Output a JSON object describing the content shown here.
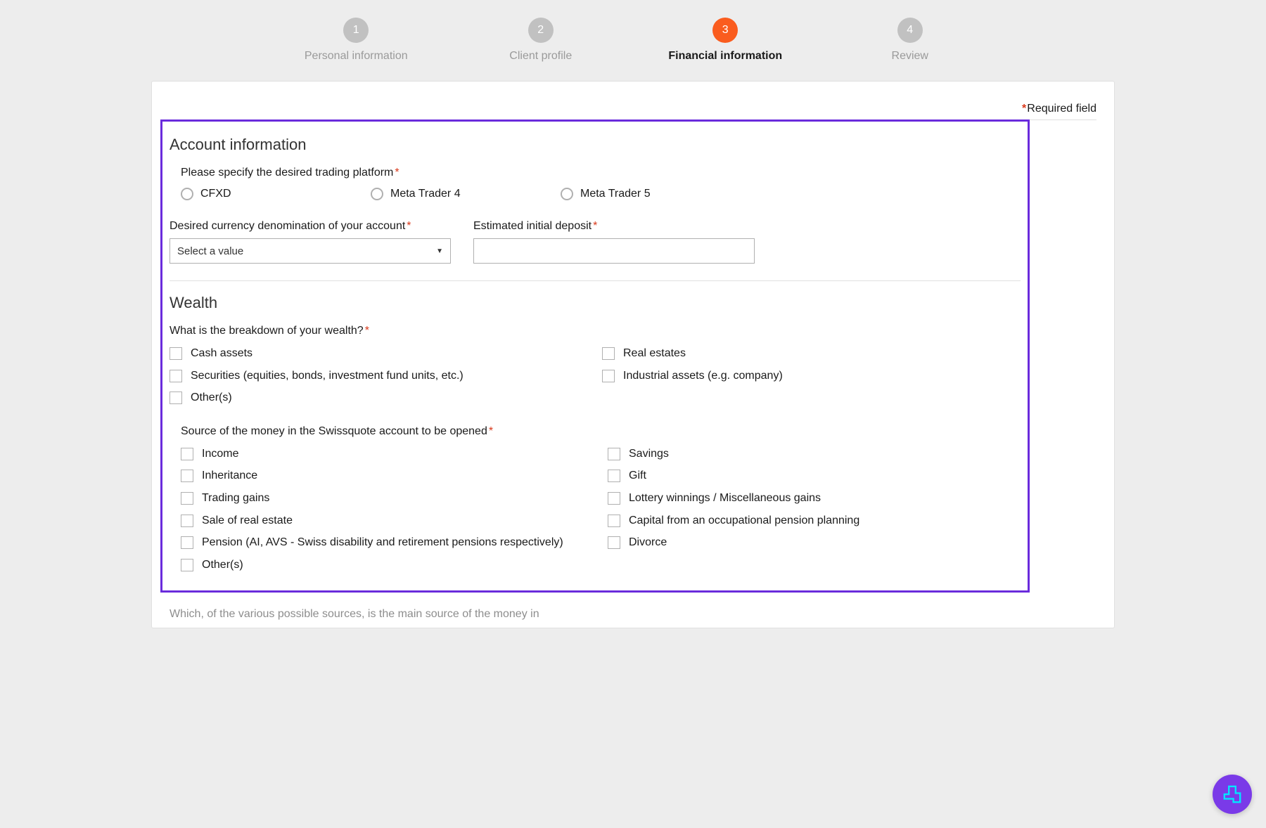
{
  "stepper": {
    "steps": [
      {
        "num": "1",
        "label": "Personal information",
        "active": false
      },
      {
        "num": "2",
        "label": "Client profile",
        "active": false
      },
      {
        "num": "3",
        "label": "Financial information",
        "active": true
      },
      {
        "num": "4",
        "label": "Review",
        "active": false
      }
    ]
  },
  "required_label": "Required field",
  "sections": {
    "account_info": {
      "title": "Account information",
      "platform_question": "Please specify the desired trading platform",
      "platform_options": [
        "CFXD",
        "Meta Trader 4",
        "Meta Trader 5"
      ],
      "currency_label": "Desired currency denomination of your account",
      "currency_placeholder": "Select a value",
      "deposit_label": "Estimated initial deposit"
    },
    "wealth": {
      "title": "Wealth",
      "breakdown_question": "What is the breakdown of your wealth?",
      "breakdown_options_left": [
        "Cash assets",
        "Securities (equities, bonds, investment fund units, etc.)",
        "Other(s)"
      ],
      "breakdown_options_right": [
        "Real estates",
        "Industrial assets (e.g. company)"
      ],
      "source_question": "Source of the money in the Swissquote account to be opened",
      "source_options_left": [
        "Income",
        "Inheritance",
        "Trading gains",
        "Sale of real estate",
        "Pension (AI, AVS - Swiss disability and retirement pensions respectively)",
        "Other(s)"
      ],
      "source_options_right": [
        "Savings",
        "Gift",
        "Lottery winnings / Miscellaneous gains",
        "Capital from an occupational pension planning",
        "Divorce"
      ]
    }
  },
  "cutoff_text": "Which, of the various possible sources, is the main source of the money in"
}
